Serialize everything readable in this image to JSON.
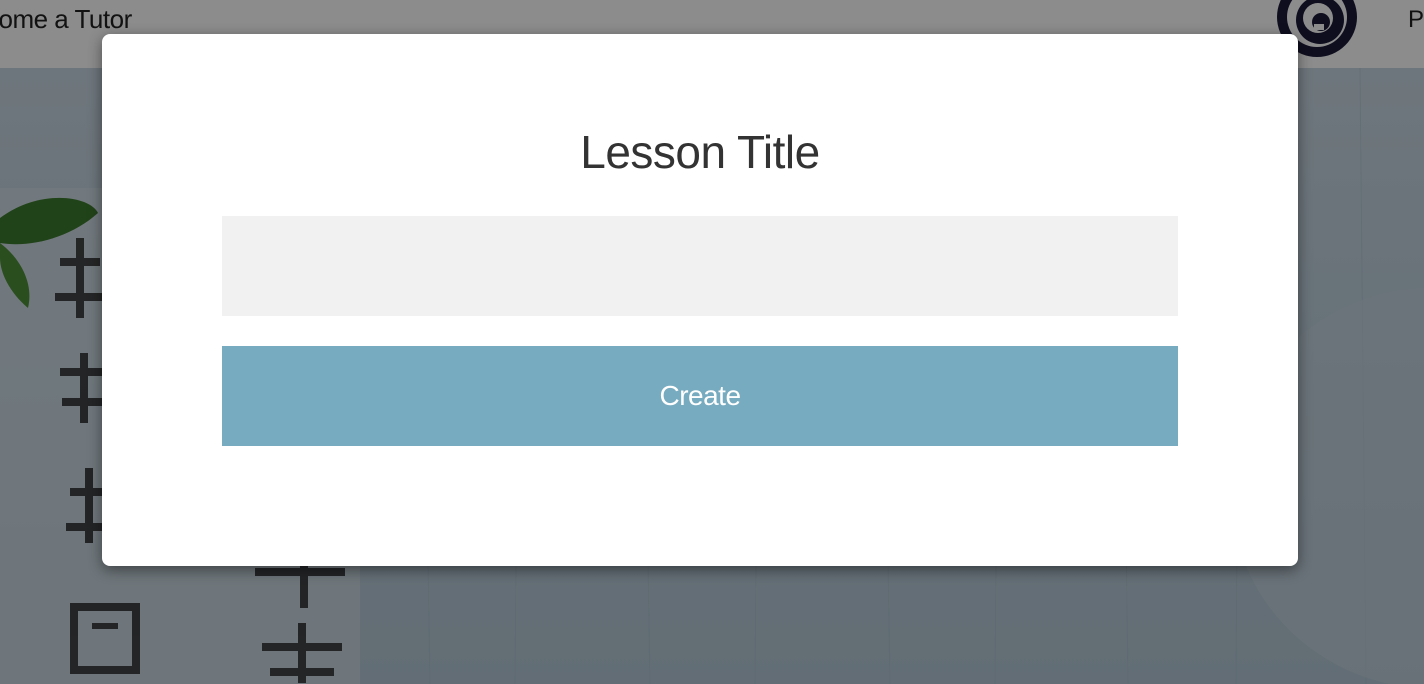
{
  "nav": {
    "tutor_link": "come a Tutor",
    "right_link": "P",
    "logo_icon": "spiral-logo-icon"
  },
  "modal": {
    "title": "Lesson Title",
    "input_value": "",
    "input_placeholder": "",
    "create_label": "Create"
  },
  "colors": {
    "create_button": "#77abc0",
    "input_background": "#f1f1f1",
    "logo": "#1c1a3a"
  }
}
